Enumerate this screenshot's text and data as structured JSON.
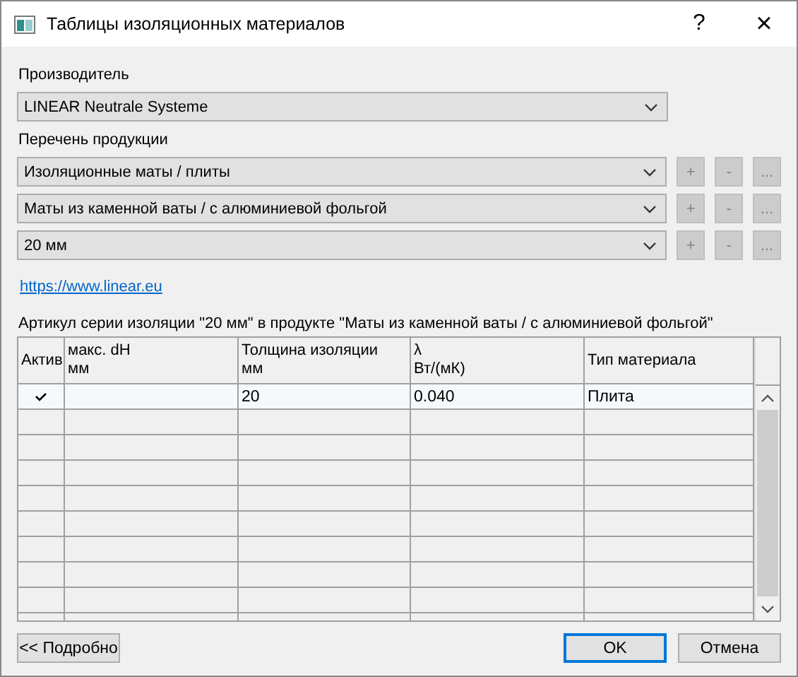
{
  "window": {
    "title": "Таблицы изоляционных материалов",
    "help": "?",
    "close": "×"
  },
  "manufacturer": {
    "label": "Производитель",
    "value": "LINEAR Neutrale Systeme"
  },
  "products": {
    "label": "Перечень продукции",
    "combos": [
      {
        "value": "Изоляционные маты / плиты",
        "buttons": [
          {
            "label": "+",
            "disabled": true
          },
          {
            "label": "-",
            "disabled": true
          },
          {
            "label": "...",
            "disabled": true
          }
        ]
      },
      {
        "value": "Маты из каменной ваты / с алюминиевой фольгой",
        "buttons": [
          {
            "label": "+",
            "disabled": true
          },
          {
            "label": "-",
            "disabled": true
          },
          {
            "label": "...",
            "disabled": true
          }
        ]
      },
      {
        "value": "20 мм",
        "buttons": [
          {
            "label": "+",
            "disabled": true
          },
          {
            "label": "-",
            "disabled": true
          },
          {
            "label": "...",
            "disabled": true
          }
        ]
      }
    ]
  },
  "link": "https://www.linear.eu",
  "table": {
    "caption": "Артикул серии изоляции \"20 мм\" в продукте \"Маты из каменной ваты / с алюминиевой фольгой\"",
    "columns": [
      "Актив",
      "макс. dH\nмм",
      "Толщина изоляции\nмм",
      "λ\nВт/(мК)",
      "Тип материала"
    ],
    "rows": [
      {
        "active": true,
        "cells": [
          "",
          "",
          "20",
          "0.040",
          "Плита"
        ]
      }
    ]
  },
  "buttons": [
    {
      "label": "<< Подробно",
      "default": false
    },
    {
      "label": "OK",
      "default": true
    },
    {
      "label": "Отмена",
      "default": false
    }
  ]
}
